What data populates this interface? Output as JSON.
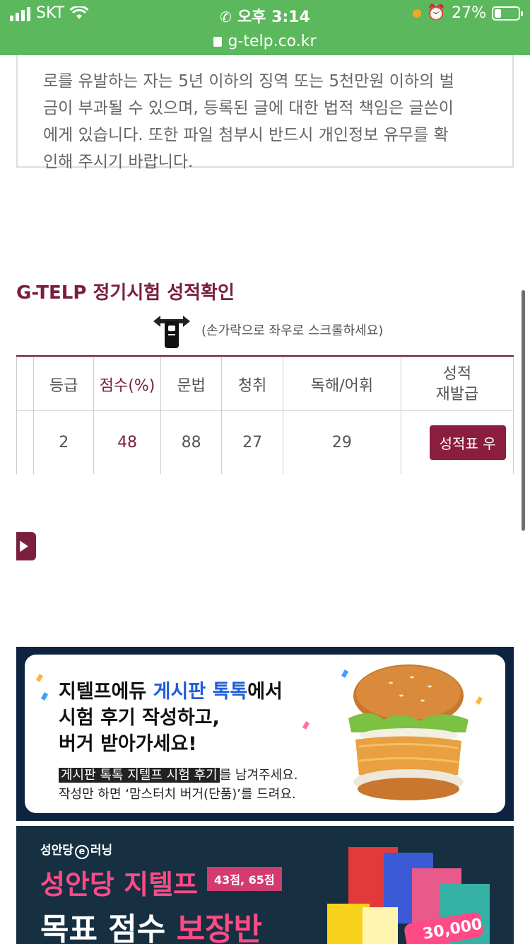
{
  "status_bar": {
    "carrier": "SKT",
    "time": "오후 3:14",
    "battery": "27%"
  },
  "url_bar": {
    "url": "g-telp.co.kr"
  },
  "notice": {
    "text": "로를 유발하는 자는 5년 이하의 징역 또는 5천만원 이하의 벌\n금이 부과될 수 있으며, 등록된 글에 대한 법적 책임은 글쓴이\n에게 있습니다. 또한 파일 첨부시 반드시 개인정보 유무를 확\n인해 주시기 바랍니다."
  },
  "section": {
    "title": "G-TELP 정기시험 성적확인",
    "swipe_hint": "(손가락으로 좌우로 스크롤하세요)"
  },
  "score_table": {
    "headers": [
      "등급",
      "점수(%)",
      "문법",
      "청취",
      "독해/어휘",
      "성적\n재발급"
    ],
    "row": {
      "grade": "2",
      "score": "48",
      "grammar": "88",
      "listening": "27",
      "reading": "29",
      "reissue_button": "성적표 우"
    }
  },
  "banner1": {
    "line1_a": "지텔프에듀 ",
    "line1_b": "게시판 톡톡",
    "line1_c": "에서",
    "line2": "시험 후기 작성하고,",
    "line3": "버거 받아가세요!",
    "small1_tag": "게시판 톡톡 지텔프 시험 후기",
    "small1_rest": "를 남겨주세요.",
    "small2": "작성만 하면 ‘맘스터치 버거(단품)’를 드려요."
  },
  "banner2": {
    "brand_a": "성안당",
    "brand_e": "e",
    "brand_b": "러닝",
    "title1": "성안당 지텔프",
    "badge": "43점, 65점",
    "title2_a": "목표 점수 ",
    "title2_b": "보장반",
    "price": "30,000"
  },
  "colors": {
    "accent": "#7a1f3d",
    "status_green": "#5cb85c",
    "button": "#8b1e3f"
  }
}
